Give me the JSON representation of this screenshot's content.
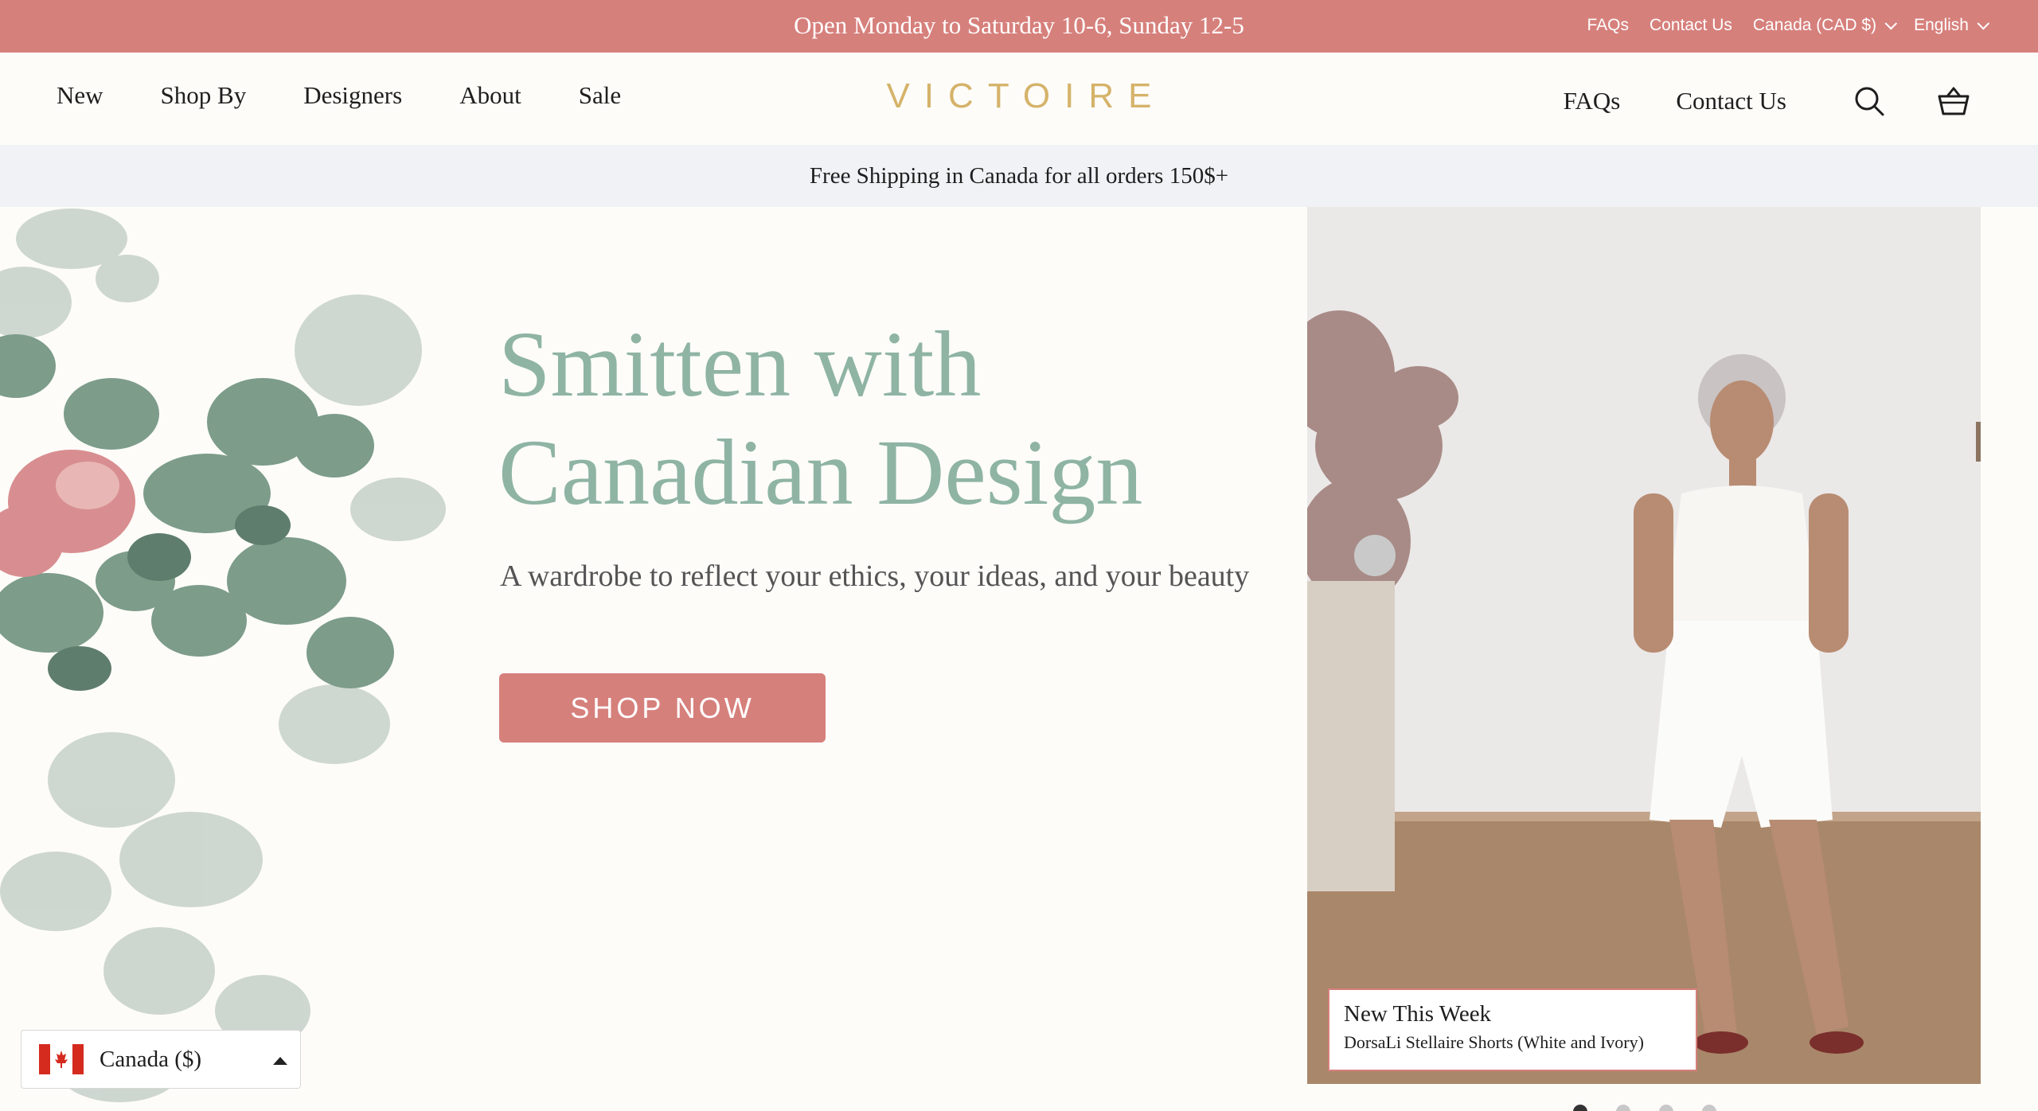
{
  "topbar": {
    "message": "Open Monday to Saturday 10-6, Sunday 12-5",
    "links": {
      "faqs": "FAQs",
      "contact": "Contact Us"
    },
    "currency": "Canada (CAD $)",
    "language": "English"
  },
  "header": {
    "nav": [
      "New",
      "Shop By",
      "Designers",
      "About",
      "Sale"
    ],
    "logo": "VICTOIRE",
    "right_links": {
      "faqs": "FAQs",
      "contact": "Contact Us"
    },
    "icons": {
      "search": "search-icon",
      "cart": "basket-icon"
    }
  },
  "shipping": {
    "message": "Free Shipping in Canada for all orders 150$+"
  },
  "hero": {
    "headline_line1": "Smitten with",
    "headline_line2": "Canadian Design",
    "subline": "A wardrobe to reflect your ethics, your ideas, and your beauty",
    "cta": "SHOP NOW",
    "slide_caption_title": "New This Week",
    "slide_caption_sub": "DorsaLi Stellaire Shorts (White and Ivory)",
    "slide_count": 4,
    "active_slide": 1
  },
  "currency_selector": {
    "label": "Canada ($)",
    "flag": "canada-flag-icon"
  },
  "colors": {
    "accent": "#d6807c",
    "headline": "#8fb4a4",
    "logo": "#d5b36a",
    "shipbar_bg": "#f1f2f5"
  }
}
